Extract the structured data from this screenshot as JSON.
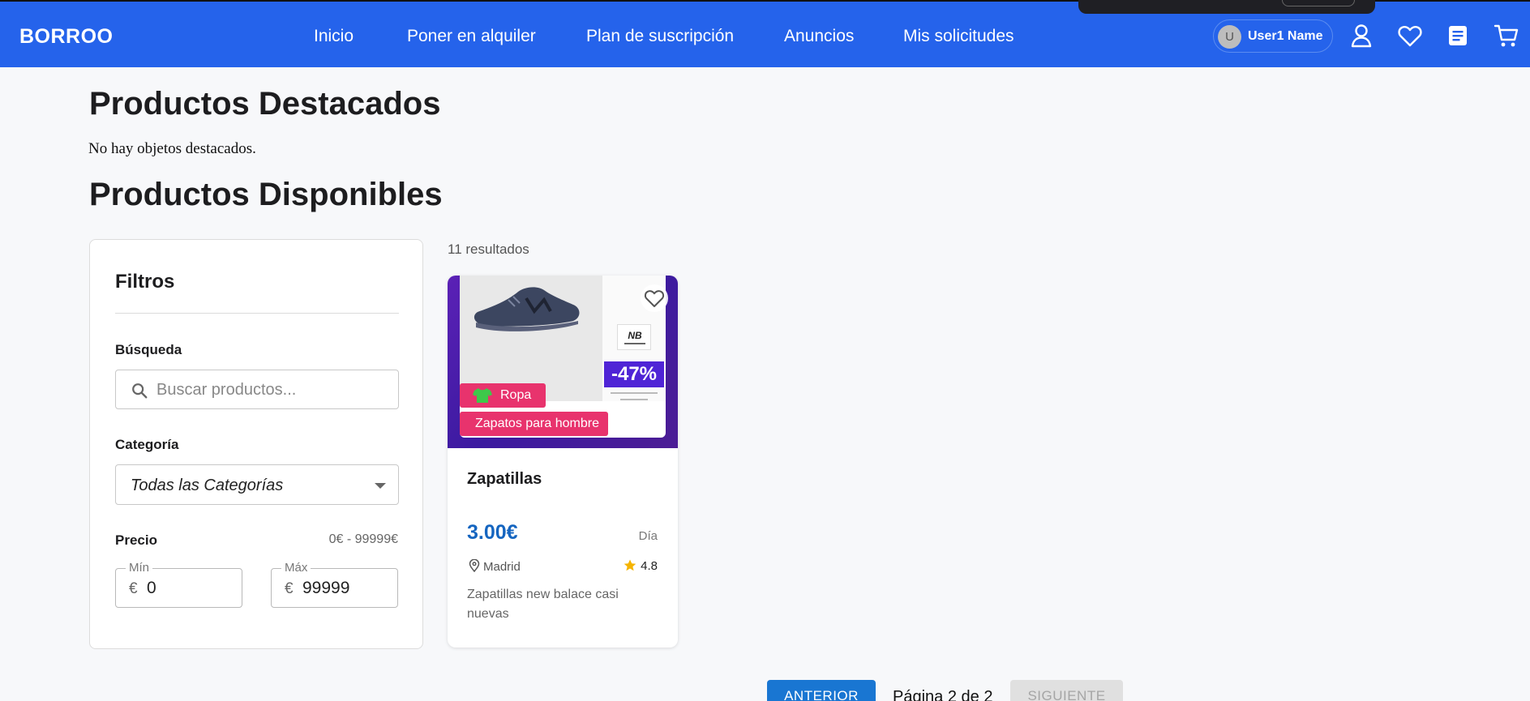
{
  "header": {
    "logo": "BORROO",
    "nav": [
      "Inicio",
      "Poner en alquiler",
      "Plan de suscripción",
      "Anuncios",
      "Mis solicitudes"
    ],
    "user": {
      "initial": "U",
      "name": "User1 Name"
    },
    "icons": [
      "user-icon",
      "heart-icon",
      "list-icon",
      "cart-icon"
    ]
  },
  "featured": {
    "title": "Productos Destacados",
    "empty_text": "No hay objetos destacados."
  },
  "available": {
    "title": "Productos Disponibles",
    "result_count": "11 resultados"
  },
  "filters": {
    "title": "Filtros",
    "search_label": "Búsqueda",
    "search_placeholder": "Buscar productos...",
    "category_label": "Categoría",
    "category_value": "Todas las Categorías",
    "price_label": "Precio",
    "price_range": "0€ - 99999€",
    "min_label": "Mín",
    "max_label": "Máx",
    "currency": "€",
    "min_value": "0",
    "max_value": "99999"
  },
  "products": [
    {
      "title": "Zapatillas",
      "category_chip": "Ropa",
      "subcategory_chip": "Zapatos para hombre",
      "image_discount": "-47%",
      "price": "3.00€",
      "period": "Día",
      "location": "Madrid",
      "rating": "4.8",
      "description": "Zapatillas new balace casi nuevas"
    }
  ],
  "pagination": {
    "prev": "ANTERIOR",
    "info": "Página 2 de 2",
    "next": "SIGUIENTE"
  },
  "colors": {
    "header_bg": "#2563eb",
    "chip": "#e8336d",
    "price": "#1565c0",
    "primary_button": "#1976d2"
  }
}
